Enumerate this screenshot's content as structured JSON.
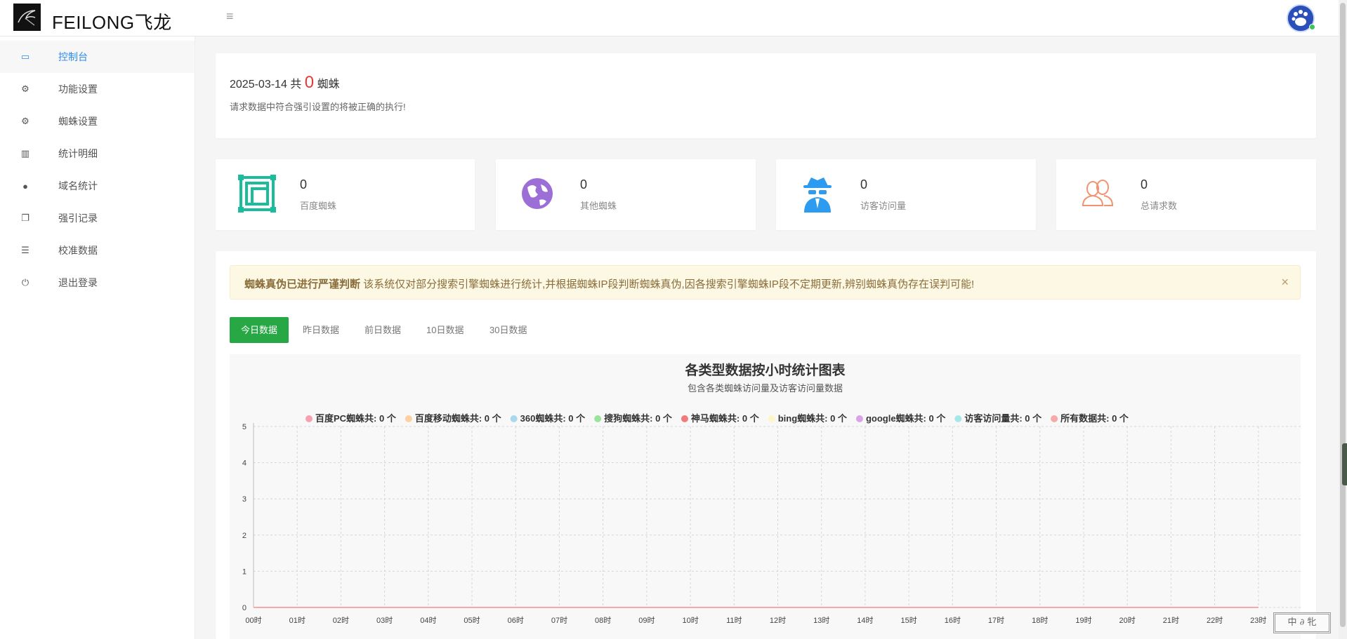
{
  "app": {
    "name": "FEILONG飞龙"
  },
  "sidebar": {
    "items": [
      {
        "label": "控制台",
        "icon": "laptop-icon",
        "active": true
      },
      {
        "label": "功能设置",
        "icon": "gears-icon"
      },
      {
        "label": "蜘蛛设置",
        "icon": "gears-icon"
      },
      {
        "label": "统计明细",
        "icon": "bar-chart-icon"
      },
      {
        "label": "域名统计",
        "icon": "globe-icon"
      },
      {
        "label": "强引记录",
        "icon": "copy-icon"
      },
      {
        "label": "校准数据",
        "icon": "list-icon"
      },
      {
        "label": "退出登录",
        "icon": "power-icon"
      }
    ]
  },
  "summary": {
    "date": "2025-03-14",
    "prefix": "共",
    "count": "0",
    "suffix": "蜘蛛",
    "note": "请求数据中符合强引设置的将被正确的执行!"
  },
  "stats": [
    {
      "value": "0",
      "label": "百度蜘蛛",
      "icon": "scan-frame-icon",
      "color": "#1bbc9b"
    },
    {
      "value": "0",
      "label": "其他蜘蛛",
      "icon": "globe-icon",
      "color": "#9b6fd6"
    },
    {
      "value": "0",
      "label": "访客访问量",
      "icon": "spy-icon",
      "color": "#2d9cf0"
    },
    {
      "value": "0",
      "label": "总请求数",
      "icon": "users-icon",
      "color": "#f19373"
    }
  ],
  "alert": {
    "title": "蜘蛛真伪已进行严谨判断",
    "message": " 该系统仅对部分搜索引擎蜘蛛进行统计,并根据蜘蛛IP段判断蜘蛛真伪,因各搜索引擎蜘蛛IP段不定期更新,辨别蜘蛛真伪存在误判可能!",
    "close": "×"
  },
  "tabs": [
    {
      "label": "今日数据",
      "active": true
    },
    {
      "label": "昨日数据"
    },
    {
      "label": "前日数据"
    },
    {
      "label": "10日数据"
    },
    {
      "label": "30日数据"
    }
  ],
  "chart_data": {
    "type": "line",
    "title": "各类型数据按小时统计图表",
    "subtitle": "包含各类蜘蛛访问量及访客访问量数据",
    "x": [
      "00时",
      "01时",
      "02时",
      "03时",
      "04时",
      "05时",
      "06时",
      "07时",
      "08时",
      "09时",
      "10时",
      "11时",
      "12时",
      "13时",
      "14时",
      "15时",
      "16时",
      "17时",
      "18时",
      "19时",
      "20时",
      "21时",
      "22时",
      "23时"
    ],
    "ylim": [
      0,
      5
    ],
    "yticks": [
      0,
      1,
      2,
      3,
      4,
      5
    ],
    "grid": true,
    "legend_position": "top",
    "series": [
      {
        "name": "百度PC蜘蛛共: 0 个",
        "color": "#f7a1b0",
        "values": [
          0,
          0,
          0,
          0,
          0,
          0,
          0,
          0,
          0,
          0,
          0,
          0,
          0,
          0,
          0,
          0,
          0,
          0,
          0,
          0,
          0,
          0,
          0,
          0
        ]
      },
      {
        "name": "百度移动蜘蛛共: 0 个",
        "color": "#fcd0a0",
        "values": [
          0,
          0,
          0,
          0,
          0,
          0,
          0,
          0,
          0,
          0,
          0,
          0,
          0,
          0,
          0,
          0,
          0,
          0,
          0,
          0,
          0,
          0,
          0,
          0
        ]
      },
      {
        "name": "360蜘蛛共: 0 个",
        "color": "#a8d8ea",
        "values": [
          0,
          0,
          0,
          0,
          0,
          0,
          0,
          0,
          0,
          0,
          0,
          0,
          0,
          0,
          0,
          0,
          0,
          0,
          0,
          0,
          0,
          0,
          0,
          0
        ]
      },
      {
        "name": "搜狗蜘蛛共: 0 个",
        "color": "#9be39b",
        "values": [
          0,
          0,
          0,
          0,
          0,
          0,
          0,
          0,
          0,
          0,
          0,
          0,
          0,
          0,
          0,
          0,
          0,
          0,
          0,
          0,
          0,
          0,
          0,
          0
        ]
      },
      {
        "name": "神马蜘蛛共: 0 个",
        "color": "#f17b7b",
        "values": [
          0,
          0,
          0,
          0,
          0,
          0,
          0,
          0,
          0,
          0,
          0,
          0,
          0,
          0,
          0,
          0,
          0,
          0,
          0,
          0,
          0,
          0,
          0,
          0
        ]
      },
      {
        "name": "bing蜘蛛共: 0 个",
        "color": "#fdf6c8",
        "values": [
          0,
          0,
          0,
          0,
          0,
          0,
          0,
          0,
          0,
          0,
          0,
          0,
          0,
          0,
          0,
          0,
          0,
          0,
          0,
          0,
          0,
          0,
          0,
          0
        ]
      },
      {
        "name": "google蜘蛛共: 0 个",
        "color": "#d9a3e6",
        "values": [
          0,
          0,
          0,
          0,
          0,
          0,
          0,
          0,
          0,
          0,
          0,
          0,
          0,
          0,
          0,
          0,
          0,
          0,
          0,
          0,
          0,
          0,
          0,
          0
        ]
      },
      {
        "name": "访客访问量共: 0 个",
        "color": "#a6e8e8",
        "values": [
          0,
          0,
          0,
          0,
          0,
          0,
          0,
          0,
          0,
          0,
          0,
          0,
          0,
          0,
          0,
          0,
          0,
          0,
          0,
          0,
          0,
          0,
          0,
          0
        ]
      },
      {
        "name": "所有数据共: 0 个",
        "color": "#f7a8a8",
        "values": [
          0,
          0,
          0,
          0,
          0,
          0,
          0,
          0,
          0,
          0,
          0,
          0,
          0,
          0,
          0,
          0,
          0,
          0,
          0,
          0,
          0,
          0,
          0,
          0
        ]
      }
    ]
  },
  "corner_stamp": "中 ∂ 牝",
  "colors": {
    "accent": "#2d8cf0",
    "success": "#28a745",
    "danger": "#e43a3a"
  }
}
